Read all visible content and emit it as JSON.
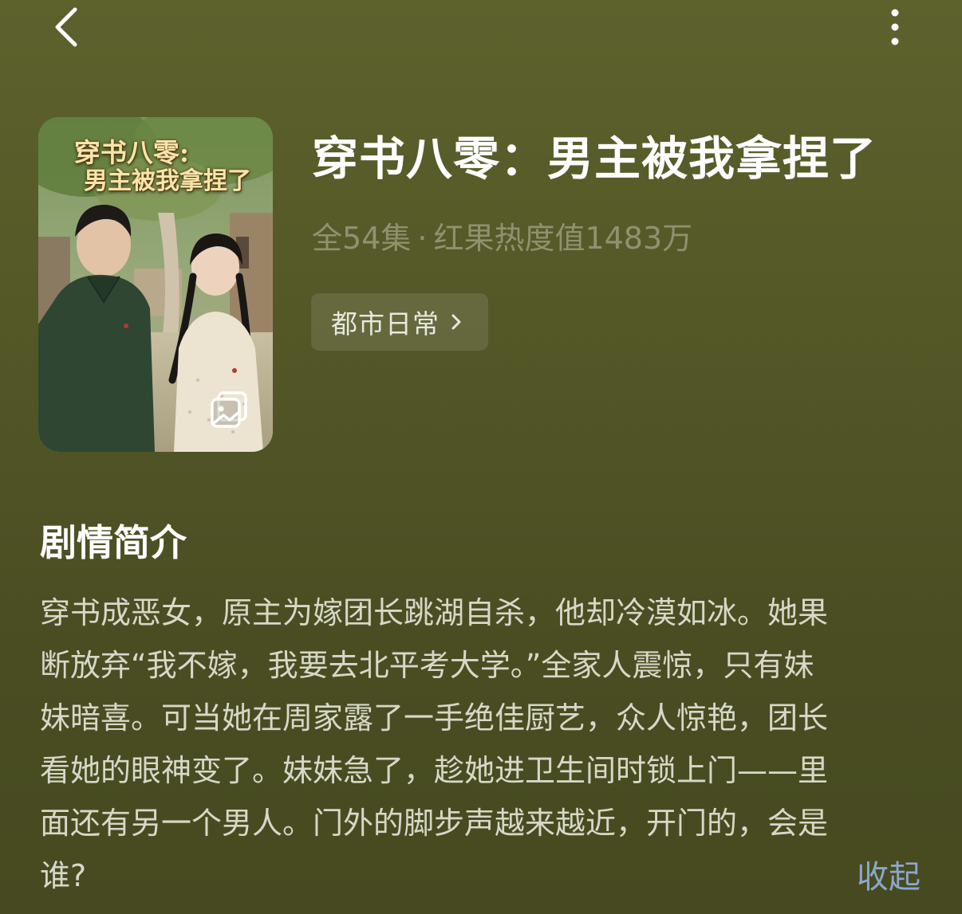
{
  "nav": {
    "back_icon": "chevron-left-icon",
    "more_icon": "more-vertical-icon"
  },
  "poster": {
    "title_line1": "穿书八零:",
    "title_line2": "男主被我拿捏了",
    "gallery_icon": "image-gallery-icon"
  },
  "drama": {
    "title": "穿书八零：男主被我拿捏了",
    "episodes": "全54集",
    "separator": "·",
    "popularity": "红果热度值1483万",
    "genre_tag": "都市日常"
  },
  "synopsis": {
    "heading": "剧情简介",
    "lines": [
      "穿书成恶女，原主为嫁团长跳湖自杀，他却冷漠如冰。她果",
      "断放弃“我不嫁，我要去北平考大学。”全家人震惊，只有妹",
      "妹暗喜。可当她在周家露了一手绝佳厨艺，众人惊艳，团长",
      "看她的眼神变了。妹妹急了，趁她进卫生间时锁上门——里",
      "面还有另一个男人。门外的脚步声越来越近，开门的，会是",
      "谁?"
    ],
    "collapse_label": "收起"
  },
  "colors": {
    "background": "#545827",
    "meta_text": "#8f9270",
    "link_blue": "#8aa8cc",
    "body_text": "#d7d8c8"
  }
}
